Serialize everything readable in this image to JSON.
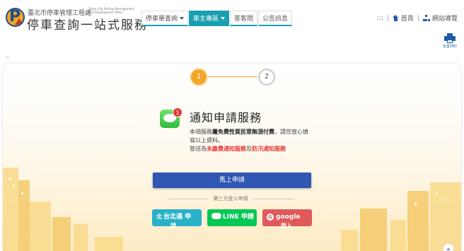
{
  "header": {
    "org_name": "臺北市停車管理工程處",
    "org_en": "Taipei City Parking Management and Development Office",
    "site_title": "停車查詢一站式服務",
    "nav": [
      {
        "label": "停車單查詢",
        "has_dropdown": true,
        "active": false
      },
      {
        "label": "車主專區",
        "has_dropdown": true,
        "active": true
      },
      {
        "label": "答客問",
        "has_dropdown": false,
        "active": false
      },
      {
        "label": "公告訊息",
        "has_dropdown": false,
        "active": false
      }
    ],
    "top_links": {
      "dots": ":::",
      "home": "首頁",
      "sitemap": "網站導覽"
    },
    "print_label": "友善列印",
    "accent_color": "#1a9fb0"
  },
  "breadcrumb_dots": ":::",
  "steps": {
    "current": "1",
    "next": "2"
  },
  "service": {
    "icon": "message-icon",
    "badge_count": "1",
    "title": "通知申請服務",
    "desc_prefix": "本項服務",
    "desc_bold": "屬免費性質民眾無須付費",
    "desc_suffix": "，請您放心填寫以上資料。",
    "desc_line2_prefix": "發送為",
    "desc_red1": "未繳費通知服務",
    "desc_and": "及",
    "desc_red2": "防汛通知服務"
  },
  "apply_button": "馬上申請",
  "third_party_divider": "第三方登入申請",
  "login_buttons": {
    "taipei": {
      "icon_text": "北",
      "label": "台北通 申",
      "overflow": "請"
    },
    "line": {
      "icon_text": "LINE",
      "label": "LINE 申請"
    },
    "google": {
      "icon_text": "G",
      "label": "google",
      "overflow": "登入"
    }
  },
  "colors": {
    "step_active": "#f4a62a",
    "apply_button": "#2f57b3",
    "taipei_button": "#2ab0c9",
    "line_button": "#06c755",
    "google_button": "#e05a5a",
    "highlight_red": "#e53935"
  }
}
